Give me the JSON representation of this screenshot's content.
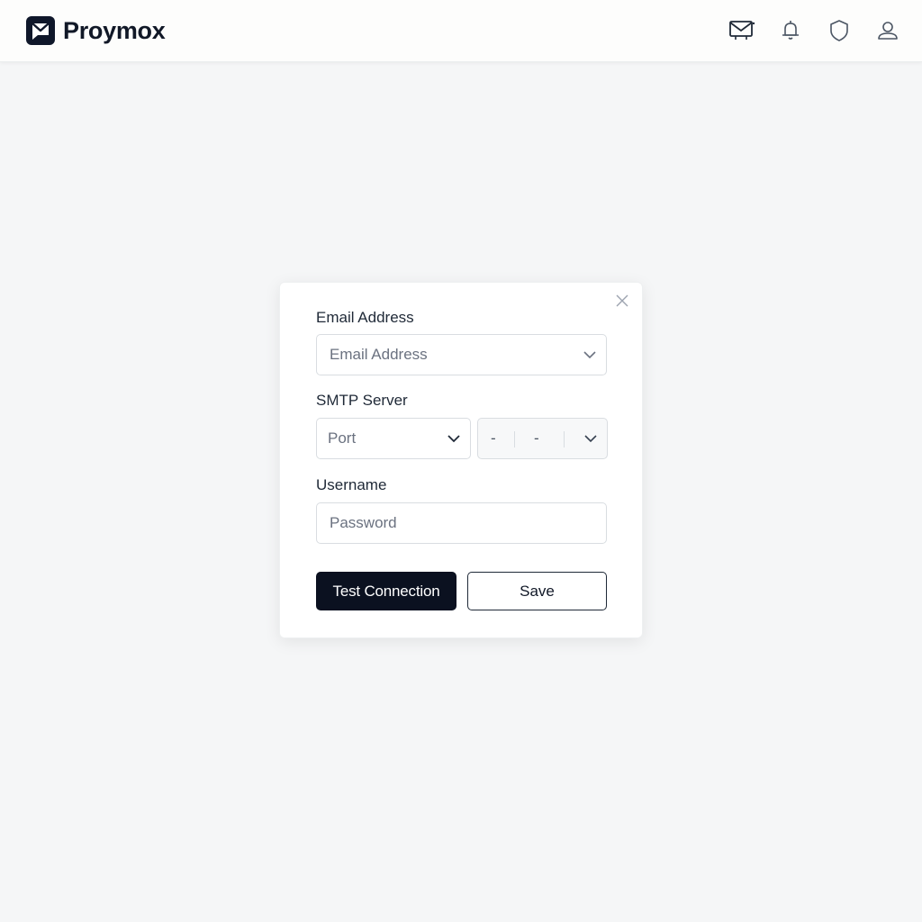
{
  "app": {
    "name": "Proymox",
    "logo_icon": "mail-logo-icon"
  },
  "header": {
    "icons": [
      {
        "name": "mail-icon"
      },
      {
        "name": "bell-icon"
      },
      {
        "name": "shield-icon"
      },
      {
        "name": "user-icon"
      }
    ]
  },
  "dialog": {
    "email": {
      "label": "Email Address",
      "placeholder": "Email Address"
    },
    "smtp": {
      "label": "SMTP Server",
      "port_placeholder": "Port",
      "segment_1": "-",
      "segment_2": "-"
    },
    "username": {
      "label": "Username",
      "placeholder": "Password"
    },
    "buttons": {
      "test": "Test Connection",
      "save": "Save"
    }
  },
  "colors": {
    "primary_button": "#0b1120",
    "background": "#f5f6f7",
    "border": "#d9dde1"
  }
}
